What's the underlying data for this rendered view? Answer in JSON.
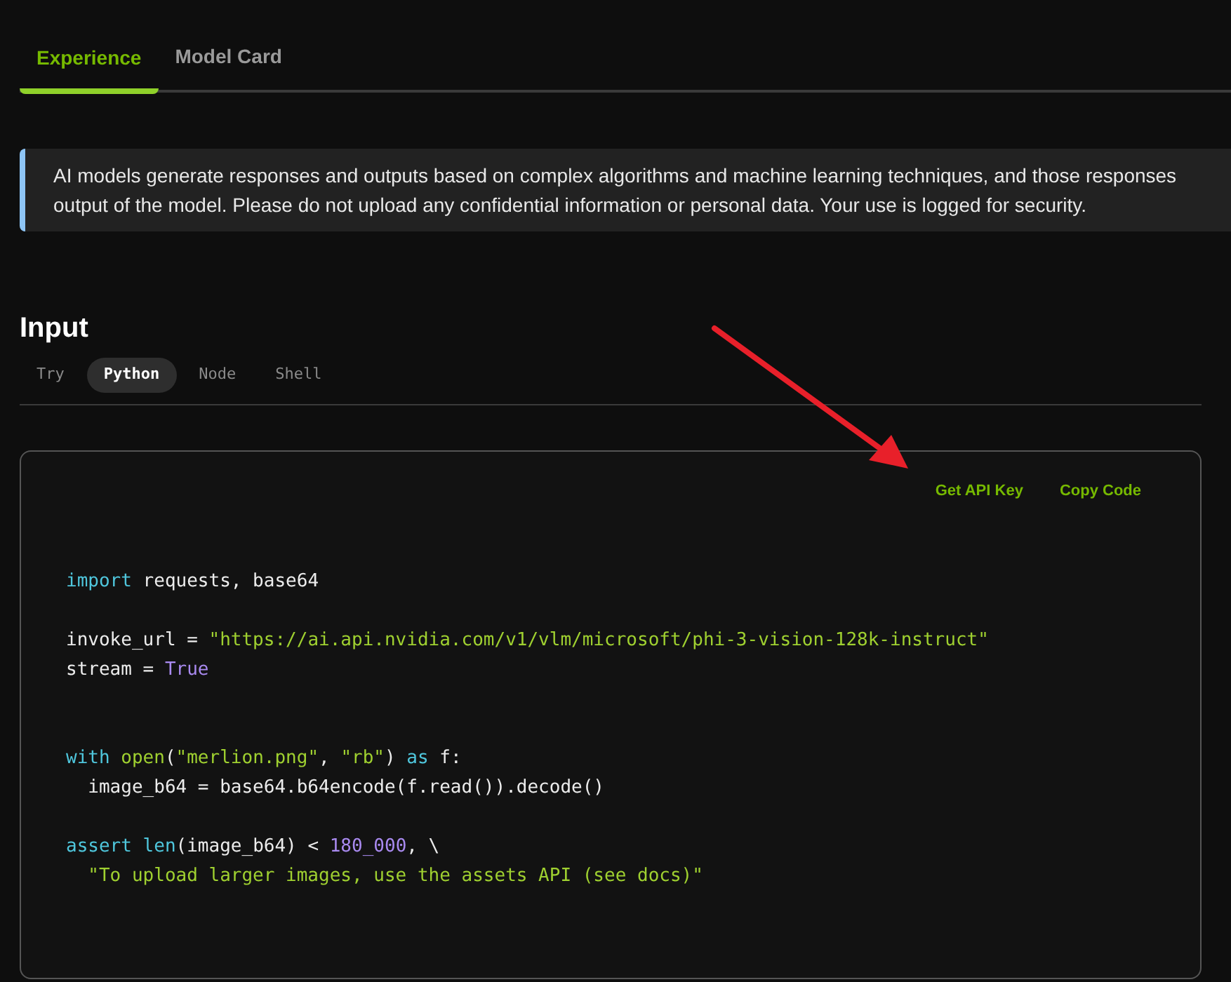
{
  "tabs": [
    {
      "label": "Experience",
      "selected": true
    },
    {
      "label": "Model Card",
      "selected": false
    }
  ],
  "notice": {
    "lines": [
      "AI models generate responses and outputs based on complex algorithms and machine learning techniques, and those responses",
      "output of the model. Please do not upload any confidential information or personal data. Your use is logged for security."
    ]
  },
  "input": {
    "title": "Input",
    "code_tabs": [
      {
        "label": "Try",
        "selected": false
      },
      {
        "label": "Python",
        "selected": true
      },
      {
        "label": "Node",
        "selected": false
      },
      {
        "label": "Shell",
        "selected": false
      }
    ],
    "actions": [
      "Get API Key",
      "Copy Code"
    ],
    "code_lines": [
      {
        "kind": "code",
        "tokens": [
          {
            "kind": "keyword",
            "text": "import"
          },
          {
            "kind": "plain",
            "text": " requests, base64"
          }
        ]
      },
      {
        "kind": "blank"
      },
      {
        "kind": "code",
        "tokens": [
          {
            "kind": "plain",
            "text": "invoke_url = "
          },
          {
            "kind": "string",
            "text": "\"https://ai.api.nvidia.com/v1/vlm/microsoft/phi-3-vision-128k-instruct\""
          }
        ]
      },
      {
        "kind": "code",
        "tokens": [
          {
            "kind": "plain",
            "text": "stream = "
          },
          {
            "kind": "number",
            "text": "True"
          }
        ]
      },
      {
        "kind": "blank"
      },
      {
        "kind": "blank"
      },
      {
        "kind": "code",
        "tokens": [
          {
            "kind": "keyword",
            "text": "with "
          },
          {
            "kind": "string",
            "text": "open"
          },
          {
            "kind": "plain",
            "text": "("
          },
          {
            "kind": "string",
            "text": "\"merlion.png\""
          },
          {
            "kind": "plain",
            "text": ", "
          },
          {
            "kind": "string",
            "text": "\"rb\""
          },
          {
            "kind": "plain",
            "text": ") "
          },
          {
            "kind": "keyword",
            "text": "as"
          },
          {
            "kind": "plain",
            "text": " f:"
          }
        ]
      },
      {
        "kind": "code",
        "tokens": [
          {
            "kind": "plain",
            "text": "  image_b64 = base64.b64encode(f.read()).decode()"
          }
        ]
      },
      {
        "kind": "blank"
      },
      {
        "kind": "code",
        "tokens": [
          {
            "kind": "keyword",
            "text": "assert len"
          },
          {
            "kind": "plain",
            "text": "(image_b64) < "
          },
          {
            "kind": "number",
            "text": "180_000"
          },
          {
            "kind": "plain",
            "text": ", \\"
          }
        ]
      },
      {
        "kind": "code",
        "tokens": [
          {
            "kind": "string",
            "text": "  \"To upload larger images, use the assets API (see docs)\""
          }
        ]
      }
    ]
  }
}
